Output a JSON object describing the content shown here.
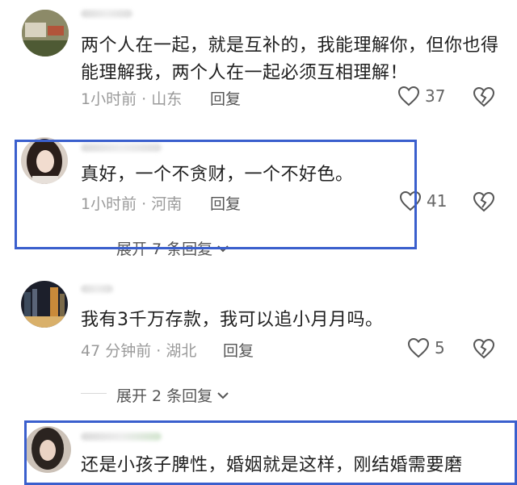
{
  "comments": [
    {
      "text": "两个人在一起，就是互补的，我能理解你，但你也得能理解我，两个人在一起必须互相理解！",
      "time_location": "1小时前 · 山东",
      "reply_label": "回复",
      "likes": "37"
    },
    {
      "text": "真好，一个不贪财，一个不好色。",
      "time_location": "1小时前 · 河南",
      "reply_label": "回复",
      "likes": "41",
      "expand_label": "展开 7 条回复"
    },
    {
      "text": "我有3千万存款，我可以追小月月吗。",
      "time_location": "47 分钟前 · 湖北",
      "reply_label": "回复",
      "likes": "5",
      "expand_label": "展开 2 条回复"
    },
    {
      "text": "还是小孩子脾性，婚姻就是这样，刚结婚需要磨"
    }
  ],
  "colors": {
    "highlight_border": "#3a5fcd",
    "meta_text": "#9a9a9a"
  },
  "icons": [
    "heart-icon",
    "broken-heart-icon",
    "chevron-down-icon"
  ]
}
